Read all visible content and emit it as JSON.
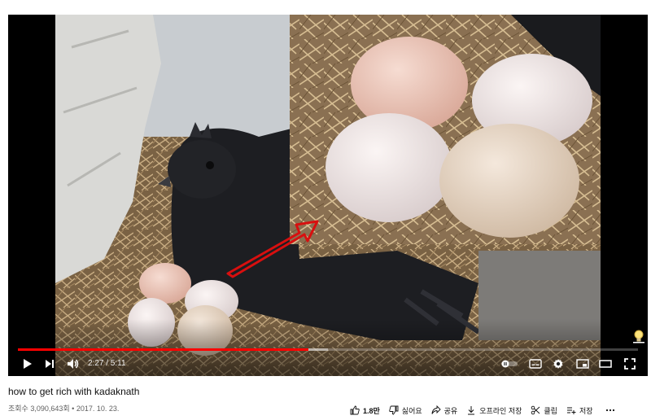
{
  "player": {
    "time_display": "2:27 / 5:11",
    "progress_played_fraction": 0.468,
    "progress_loaded_fraction": 0.5,
    "accent_color": "#ff0000",
    "controls": {
      "play": "play-icon",
      "next": "next-icon",
      "volume": "volume-icon",
      "autoplay": "autoplay-toggle-icon",
      "subtitles": "subtitles-icon",
      "settings": "gear-icon",
      "miniplayer": "miniplayer-icon",
      "theater": "theater-mode-icon",
      "fullscreen": "fullscreen-icon",
      "corner_badge": "lightbulb-icon"
    }
  },
  "video": {
    "title": "how to get rich with kadaknath",
    "views": "조회수 3,090,643회",
    "separator": " • ",
    "date": "2017. 10. 23."
  },
  "actions": {
    "like_count": "1.8만",
    "dislike_label": "싫어요",
    "share_label": "공유",
    "offline_label": "오프라인 저장",
    "clip_label": "클립",
    "save_label": "저장"
  }
}
